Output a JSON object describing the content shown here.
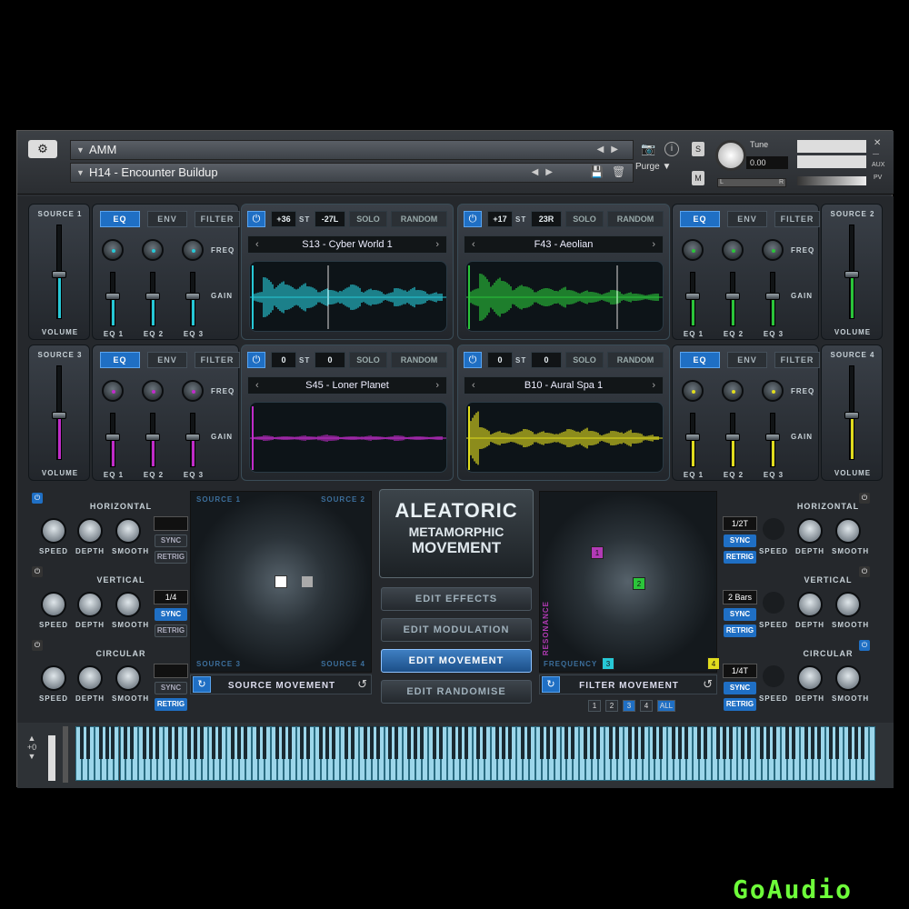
{
  "header": {
    "preset_folder": "AMM",
    "preset_name": "H14 - Encounter Buildup",
    "purge": "Purge",
    "tune_label": "Tune",
    "tune_value": "0.00",
    "aux": "AUX",
    "pv": "PV",
    "s_btn": "S",
    "m_btn": "M",
    "l": "L",
    "r": "R"
  },
  "sources": [
    {
      "title": "SOURCE 1",
      "volume": "VOLUME",
      "tabs": [
        "EQ",
        "ENV",
        "FILTER"
      ],
      "transpose": "+36",
      "st": "ST",
      "pan": "-27L",
      "solo": "SOLO",
      "random": "RANDOM",
      "sample": "S13 - Cyber World 1",
      "eq_labels": [
        "EQ 1",
        "EQ 2",
        "EQ 3"
      ],
      "freq": "FREQ",
      "gain": "GAIN",
      "color": "#27c8d6"
    },
    {
      "title": "SOURCE 2",
      "volume": "VOLUME",
      "tabs": [
        "EQ",
        "ENV",
        "FILTER"
      ],
      "transpose": "+17",
      "st": "ST",
      "pan": "23R",
      "solo": "SOLO",
      "random": "RANDOM",
      "sample": "F43 - Aeolian",
      "eq_labels": [
        "EQ 1",
        "EQ 2",
        "EQ 3"
      ],
      "freq": "FREQ",
      "gain": "GAIN",
      "color": "#2bc43a"
    },
    {
      "title": "SOURCE 3",
      "volume": "VOLUME",
      "tabs": [
        "EQ",
        "ENV",
        "FILTER"
      ],
      "transpose": "0",
      "st": "ST",
      "pan": "0",
      "solo": "SOLO",
      "random": "RANDOM",
      "sample": "S45 - Loner Planet",
      "eq_labels": [
        "EQ 1",
        "EQ 2",
        "EQ 3"
      ],
      "freq": "FREQ",
      "gain": "GAIN",
      "color": "#c02cc8"
    },
    {
      "title": "SOURCE 4",
      "volume": "VOLUME",
      "tabs": [
        "EQ",
        "ENV",
        "FILTER"
      ],
      "transpose": "0",
      "st": "ST",
      "pan": "0",
      "solo": "SOLO",
      "random": "RANDOM",
      "sample": "B10 - Aural Spa 1",
      "eq_labels": [
        "EQ 1",
        "EQ 2",
        "EQ 3"
      ],
      "freq": "FREQ",
      "gain": "GAIN",
      "color": "#e0dc1e"
    }
  ],
  "movement_left": {
    "horizontal": "HORIZONTAL",
    "vertical": "VERTICAL",
    "circular": "CIRCULAR",
    "speed": "SPEED",
    "depth": "DEPTH",
    "smooth": "SMOOTH",
    "sync": "SYNC",
    "retrig": "RETRIG",
    "vertical_value": "1/4"
  },
  "movement_right": {
    "horizontal": "HORIZONTAL",
    "vertical": "VERTICAL",
    "circular": "CIRCULAR",
    "speed": "SPEED",
    "depth": "DEPTH",
    "smooth": "SMOOTH",
    "sync": "SYNC",
    "retrig": "RETRIG",
    "h_value": "1/2T",
    "v_value": "2 Bars",
    "c_value": "1/4T"
  },
  "source_pad": {
    "src1": "SOURCE 1",
    "src2": "SOURCE 2",
    "src3": "SOURCE 3",
    "src4": "SOURCE 4",
    "title": "SOURCE MOVEMENT"
  },
  "filter_pad": {
    "resonance": "RESONANCE",
    "frequency": "FREQUENCY",
    "title": "FILTER MOVEMENT",
    "pages": [
      "1",
      "2",
      "3",
      "4",
      "ALL"
    ],
    "nodes": [
      "1",
      "2",
      "3",
      "4"
    ]
  },
  "logo": {
    "line1": "ALEATORIC",
    "line2": "METAMORPHIC",
    "line3": "MOVEMENT"
  },
  "menu": [
    "EDIT EFFECTS",
    "EDIT MODULATION",
    "EDIT MOVEMENT",
    "EDIT RANDOMISE"
  ],
  "keyboard": {
    "octave": "+0"
  },
  "watermark": "GoAudio"
}
